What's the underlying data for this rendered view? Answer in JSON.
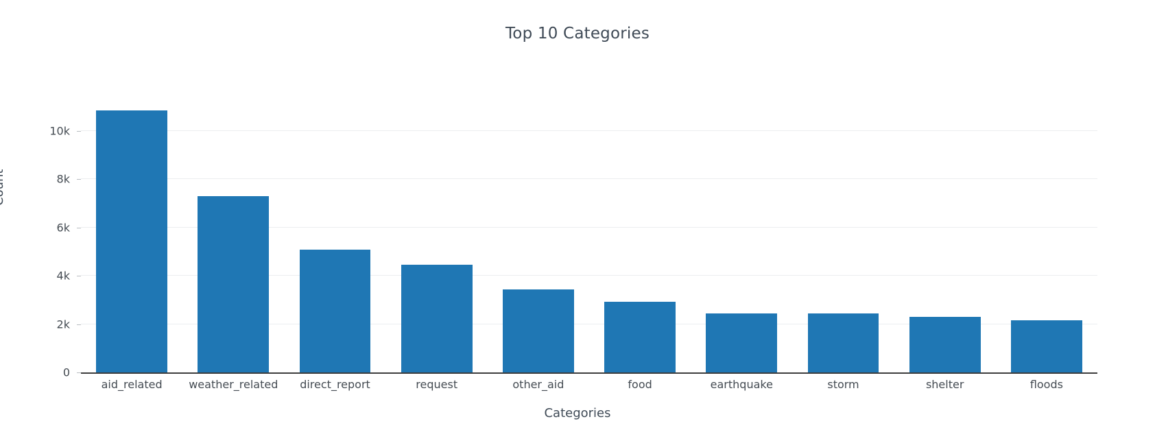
{
  "chart_data": {
    "type": "bar",
    "title": "Top 10 Categories",
    "xlabel": "Categories",
    "ylabel": "Count",
    "categories": [
      "aid_related",
      "weather_related",
      "direct_report",
      "request",
      "other_aid",
      "food",
      "earthquake",
      "storm",
      "shelter",
      "floods"
    ],
    "values": [
      10850,
      7300,
      5080,
      4470,
      3440,
      2920,
      2450,
      2440,
      2310,
      2160
    ],
    "ylim": [
      0,
      11450
    ],
    "yticks": [
      0,
      2000,
      4000,
      6000,
      8000,
      10000
    ],
    "ytick_labels": [
      "0",
      "2k",
      "4k",
      "6k",
      "8k",
      "10k"
    ],
    "grid": true,
    "legend": false,
    "bar_color": "#1f77b4",
    "gridline_color": "#eceef0",
    "axis_color": "#3d3d3d",
    "background_color": "#ffffff"
  }
}
